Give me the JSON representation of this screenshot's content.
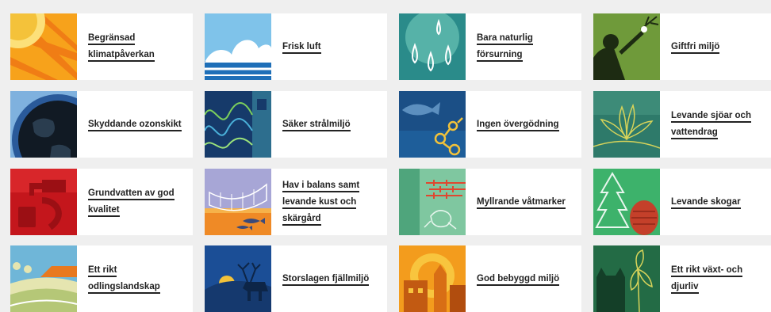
{
  "cards": [
    {
      "label": "Begränsad\nklimatpåverkan",
      "icon": "sun-icon"
    },
    {
      "label": "Frisk luft",
      "icon": "cloud-icon"
    },
    {
      "label": "Bara naturlig\nförsurning",
      "icon": "raindrops-icon"
    },
    {
      "label": "Giftfri miljö",
      "icon": "person-branch-icon"
    },
    {
      "label": "Skyddande ozonskikt",
      "icon": "earth-icon"
    },
    {
      "label": "Säker strålmiljö",
      "icon": "radiation-waves-icon"
    },
    {
      "label": "Ingen övergödning",
      "icon": "fish-algae-icon"
    },
    {
      "label": "Levande sjöar och\nvattendrag",
      "icon": "water-lily-icon"
    },
    {
      "label": "Grundvatten av god\nkvalitet",
      "icon": "water-tap-icon"
    },
    {
      "label": "Hav i balans samt\nlevande kust och\nskärgård",
      "icon": "boat-fish-icon"
    },
    {
      "label": "Myllrande våtmarker",
      "icon": "frog-icon"
    },
    {
      "label": "Levande skogar",
      "icon": "spruce-cone-icon"
    },
    {
      "label": "Ett rikt\nodlingslandskap",
      "icon": "farm-field-icon"
    },
    {
      "label": "Storslagen fjällmiljö",
      "icon": "reindeer-icon"
    },
    {
      "label": "God bebyggd miljö",
      "icon": "buildings-icon"
    },
    {
      "label": "Ett rikt växt- och\ndjurliv",
      "icon": "lynx-orchid-icon"
    }
  ]
}
